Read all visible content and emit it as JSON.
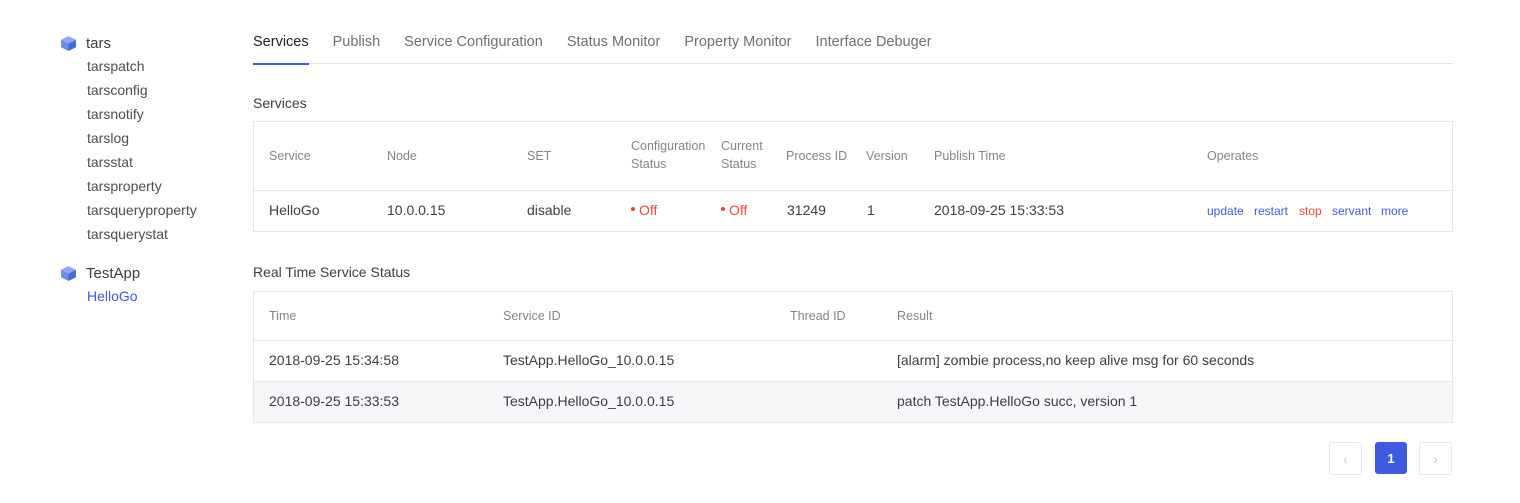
{
  "sidebar": {
    "groups": [
      {
        "label": "tars",
        "children": [
          "tarspatch",
          "tarsconfig",
          "tarsnotify",
          "tarslog",
          "tarsstat",
          "tarsproperty",
          "tarsqueryproperty",
          "tarsquerystat"
        ]
      },
      {
        "label": "TestApp",
        "children": [
          "HelloGo"
        ]
      }
    ]
  },
  "tabs": [
    "Services",
    "Publish",
    "Service Configuration",
    "Status Monitor",
    "Property Monitor",
    "Interface Debuger"
  ],
  "services": {
    "title": "Services",
    "headers": {
      "service": "Service",
      "node": "Node",
      "set": "SET",
      "config_status_1": "Configuration",
      "config_status_2": "Status",
      "current_status_1": "Current",
      "current_status_2": "Status",
      "process_id": "Process ID",
      "version": "Version",
      "publish_time": "Publish Time",
      "operates": "Operates"
    },
    "row": {
      "service": "HelloGo",
      "node": "10.0.0.15",
      "set": "disable",
      "config_status": "Off",
      "current_status": "Off",
      "process_id": "31249",
      "version": "1",
      "publish_time": "2018-09-25 15:33:53",
      "ops": {
        "update": "update",
        "restart": "restart",
        "stop": "stop",
        "servant": "servant",
        "more": "more"
      }
    }
  },
  "realtime": {
    "title": "Real Time Service Status",
    "headers": {
      "time": "Time",
      "service_id": "Service ID",
      "thread_id": "Thread ID",
      "result": "Result"
    },
    "rows": [
      {
        "time": "2018-09-25 15:34:58",
        "service_id": "TestApp.HelloGo_10.0.0.15",
        "thread_id": "",
        "result": "[alarm] zombie process,no keep alive msg for 60 seconds"
      },
      {
        "time": "2018-09-25 15:33:53",
        "service_id": "TestApp.HelloGo_10.0.0.15",
        "thread_id": "",
        "result": "patch TestApp.HelloGo succ, version 1"
      }
    ]
  },
  "pagination": {
    "prev": "‹",
    "current": "1",
    "next": "›"
  },
  "colors": {
    "accent": "#3f5ae0",
    "off": "#e8483a"
  }
}
